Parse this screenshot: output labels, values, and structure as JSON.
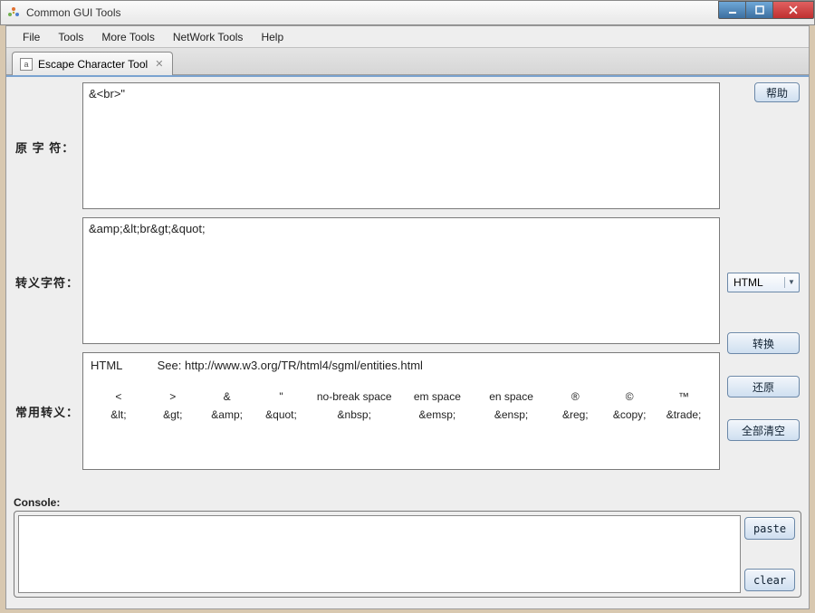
{
  "window": {
    "title": "Common GUI Tools"
  },
  "menu": {
    "file": "File",
    "tools": "Tools",
    "more_tools": "More Tools",
    "network_tools": "NetWork Tools",
    "help": "Help"
  },
  "tab": {
    "label": "Escape Character Tool"
  },
  "labels": {
    "original": "原 字 符：",
    "escaped": "转义字符：",
    "common": "常用转义：",
    "console": "Console:"
  },
  "fields": {
    "original_value": "&<br>\"",
    "escaped_value": "&amp;&lt;br&gt;&quot;"
  },
  "reference": {
    "header_prefix": "HTML",
    "header_see": "See: http://www.w3.org/TR/html4/sgml/entities.html",
    "cols": [
      {
        "char": "<",
        "entity": "&lt;"
      },
      {
        "char": ">",
        "entity": "&gt;"
      },
      {
        "char": "&",
        "entity": "&amp;"
      },
      {
        "char": "\"",
        "entity": "&quot;"
      },
      {
        "char": "no-break space",
        "entity": "&nbsp;"
      },
      {
        "char": "em space",
        "entity": "&emsp;"
      },
      {
        "char": "en space",
        "entity": "&ensp;"
      },
      {
        "char": "®",
        "entity": "&reg;"
      },
      {
        "char": "©",
        "entity": "&copy;"
      },
      {
        "char": "™",
        "entity": "&trade;"
      }
    ]
  },
  "controls": {
    "help_btn": "帮助",
    "type_select": "HTML",
    "convert_btn": "转换",
    "restore_btn": "还原",
    "clear_all_btn": "全部清空",
    "paste_btn": "paste",
    "clear_btn": "clear"
  }
}
